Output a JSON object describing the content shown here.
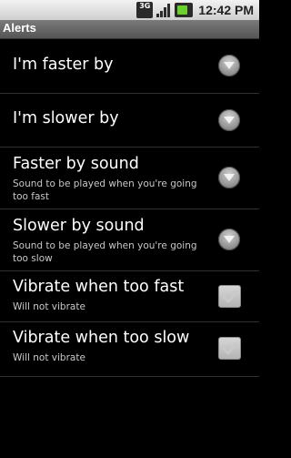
{
  "status_bar": {
    "network_label": "3G",
    "time": "12:42 PM"
  },
  "title_bar": {
    "title": "Alerts"
  },
  "preferences": [
    {
      "title": "I'm faster by",
      "summary": "",
      "widget": "dropdown-icon"
    },
    {
      "title": "I'm slower by",
      "summary": "",
      "widget": "dropdown-icon"
    },
    {
      "title": "Faster by sound",
      "summary": "Sound to be played when you're going too fast",
      "widget": "dropdown-icon"
    },
    {
      "title": "Slower by sound",
      "summary": "Sound to be played when you're going too slow",
      "widget": "dropdown-icon"
    },
    {
      "title": "Vibrate when too fast",
      "summary": "Will not vibrate",
      "widget": "checkbox",
      "checked": false
    },
    {
      "title": "Vibrate when too slow",
      "summary": "Will not vibrate",
      "widget": "checkbox",
      "checked": false
    }
  ],
  "colors": {
    "background": "#000000",
    "title_bar": "#666666",
    "status_bar": "#e0e0e0",
    "divider": "#2e2e2e",
    "summary_text": "#c8c8c8",
    "battery_accent": "#6ad02a"
  }
}
